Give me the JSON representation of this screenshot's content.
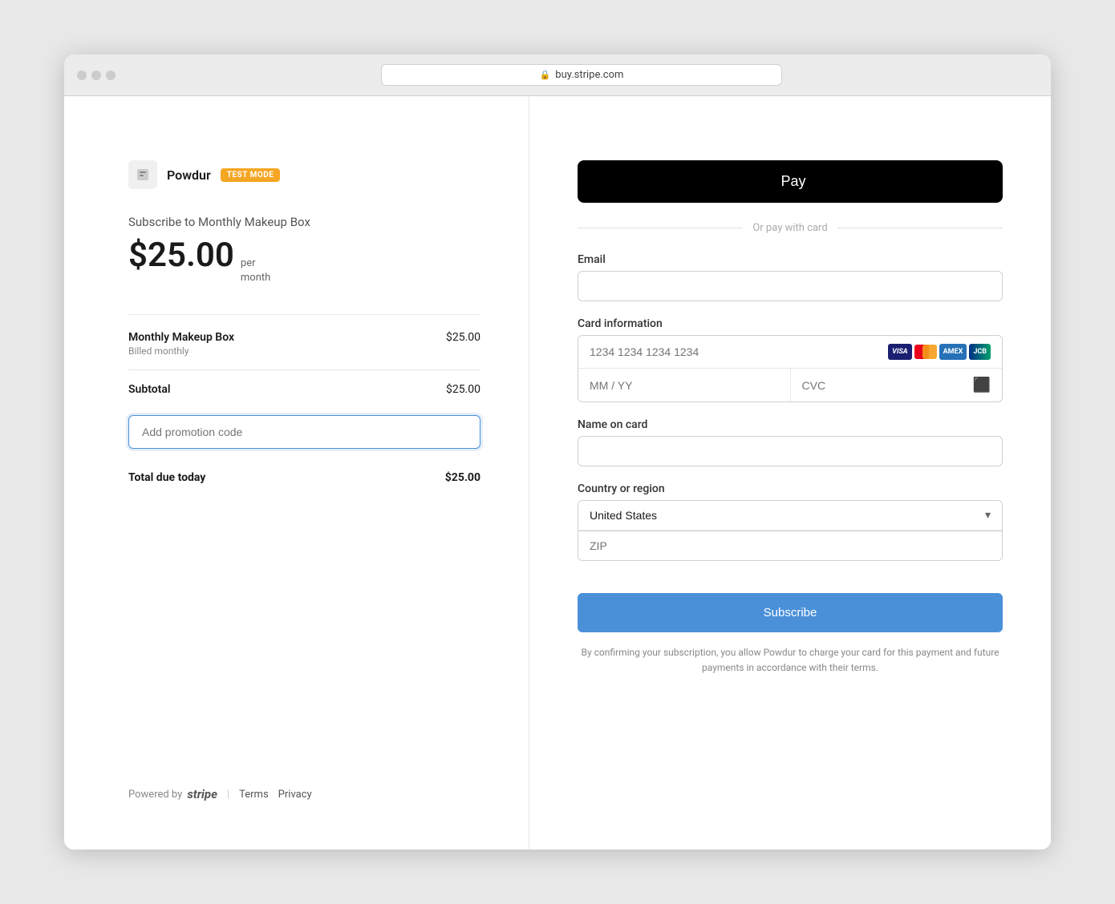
{
  "browser": {
    "url": "buy.stripe.com"
  },
  "left_panel": {
    "brand": {
      "name": "Powdur",
      "test_mode_label": "TEST MODE"
    },
    "subscription": {
      "title": "Subscribe to Monthly Makeup Box",
      "price": "$25.00",
      "period_line1": "per",
      "period_line2": "month"
    },
    "line_items": [
      {
        "label": "Monthly Makeup Box",
        "sublabel": "Billed monthly",
        "amount": "$25.00"
      }
    ],
    "subtotal": {
      "label": "Subtotal",
      "amount": "$25.00"
    },
    "promo": {
      "placeholder": "Add promotion code"
    },
    "total": {
      "label": "Total due today",
      "amount": "$25.00"
    },
    "footer": {
      "powered_by": "Powered by",
      "stripe_label": "stripe",
      "terms_label": "Terms",
      "privacy_label": "Privacy"
    }
  },
  "right_panel": {
    "apple_pay": {
      "label": "Pay"
    },
    "divider": "Or pay with card",
    "email": {
      "label": "Email",
      "placeholder": ""
    },
    "card_information": {
      "label": "Card information",
      "number_placeholder": "1234 1234 1234 1234",
      "expiry_placeholder": "MM / YY",
      "cvc_placeholder": "CVC"
    },
    "name_on_card": {
      "label": "Name on card",
      "placeholder": ""
    },
    "country_region": {
      "label": "Country or region",
      "selected": "United States",
      "zip_placeholder": "ZIP"
    },
    "subscribe_button": "Subscribe",
    "consent_text": "By confirming your subscription, you allow Powdur to charge your card for this payment and future payments in accordance with their terms."
  }
}
